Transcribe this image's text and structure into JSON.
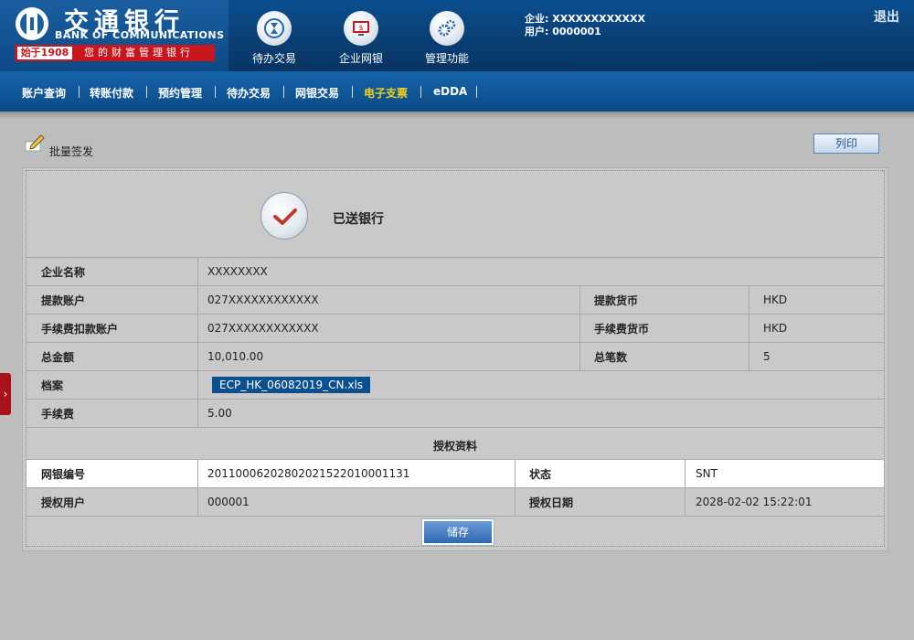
{
  "brand": {
    "name_cn": "交通银行",
    "name_en": "BANK OF COMMUNICATIONS",
    "since": "始于1908",
    "slogan": "您的财富管理银行",
    "red": "#c8161d",
    "blue": "#0b4f8f"
  },
  "topnav": [
    {
      "label": "待办交易",
      "icon": "hourglass-icon"
    },
    {
      "label": "企业网银",
      "icon": "monitor-dollar-icon"
    },
    {
      "label": "管理功能",
      "icon": "gears-icon"
    }
  ],
  "user": {
    "company": "企业: XXXXXXXXXXXX",
    "user": "用户: 0000001"
  },
  "logout": "退出",
  "menu": [
    "账户查询",
    "转账付款",
    "预约管理",
    "待办交易",
    "网银交易",
    "电子支票",
    "eDDA"
  ],
  "menu_active": "电子支票",
  "page": {
    "title": "批量签发",
    "print": "列印"
  },
  "result": {
    "status": "已送银行"
  },
  "details": {
    "company_label": "企业名称",
    "company_value": "XXXXXXXX",
    "withdraw_account_label": "提款账户",
    "withdraw_account_value": "027XXXXXXXXXXXX",
    "withdraw_currency_label": "提款货币",
    "withdraw_currency_value": "HKD",
    "fee_account_label": "手续费扣款账户",
    "fee_account_value": "027XXXXXXXXXXXX",
    "fee_currency_label": "手续费货币",
    "fee_currency_value": "HKD",
    "total_amount_label": "总金额",
    "total_amount_value": "10,010.00",
    "total_count_label": "总笔数",
    "total_count_value": "5",
    "file_label": "档案",
    "file_value": "ECP_HK_06082019_CN.xls",
    "fee_label": "手续费",
    "fee_value": "5.00"
  },
  "auth": {
    "section_title": "授权资料",
    "ref_label": "网银编号",
    "ref_value": "20110006202802021522010001131",
    "status_label": "状态",
    "status_value": "SNT",
    "user_label": "授权用户",
    "user_value": "000001",
    "date_label": "授权日期",
    "date_value": "2028-02-02 15:22:01"
  },
  "save": "储存"
}
